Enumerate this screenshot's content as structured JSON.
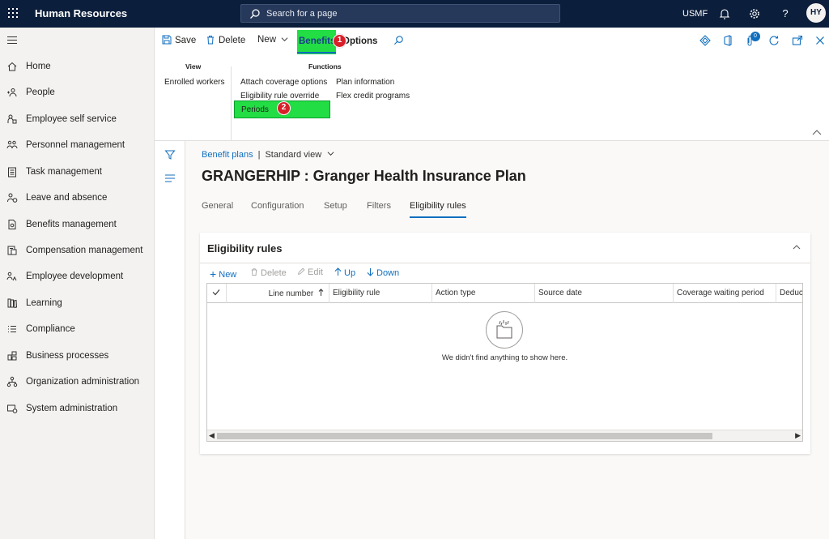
{
  "app": {
    "title": "Human Resources",
    "company": "USMF",
    "user_initials": "HY",
    "notification_count": "0"
  },
  "search": {
    "placeholder": "Search for a page"
  },
  "sidebar": {
    "items": [
      {
        "label": "Home",
        "icon": "home-icon"
      },
      {
        "label": "People",
        "icon": "people-icon"
      },
      {
        "label": "Employee self service",
        "icon": "employee-self-service-icon"
      },
      {
        "label": "Personnel management",
        "icon": "personnel-management-icon"
      },
      {
        "label": "Task management",
        "icon": "task-management-icon"
      },
      {
        "label": "Leave and absence",
        "icon": "leave-absence-icon"
      },
      {
        "label": "Benefits management",
        "icon": "benefits-management-icon"
      },
      {
        "label": "Compensation management",
        "icon": "compensation-management-icon"
      },
      {
        "label": "Employee development",
        "icon": "employee-development-icon"
      },
      {
        "label": "Learning",
        "icon": "learning-icon"
      },
      {
        "label": "Compliance",
        "icon": "compliance-icon"
      },
      {
        "label": "Business processes",
        "icon": "business-processes-icon"
      },
      {
        "label": "Organization administration",
        "icon": "organization-administration-icon"
      },
      {
        "label": "System administration",
        "icon": "system-administration-icon"
      }
    ]
  },
  "actionbar": {
    "save": "Save",
    "delete": "Delete",
    "new": "New",
    "tab_benefits": "Benefits",
    "tab_options": "Options"
  },
  "markers": {
    "m1": "1",
    "m2": "2"
  },
  "ribbon": {
    "view_header": "View",
    "functions_header": "Functions",
    "view_items": [
      "Enrolled workers"
    ],
    "functions_col1": [
      "Attach coverage options",
      "Eligibility rule override",
      "Periods"
    ],
    "functions_col2": [
      "Plan information",
      "Flex credit programs"
    ]
  },
  "breadcrumb": {
    "parent": "Benefit plans",
    "separator": "|",
    "view": "Standard view"
  },
  "page": {
    "title": "GRANGERHIP : Granger Health Insurance Plan"
  },
  "tabs": [
    {
      "label": "General"
    },
    {
      "label": "Configuration"
    },
    {
      "label": "Setup"
    },
    {
      "label": "Filters"
    },
    {
      "label": "Eligibility rules",
      "active": true
    }
  ],
  "section": {
    "title": "Eligibility rules",
    "toolbar": {
      "new": "New",
      "delete": "Delete",
      "edit": "Edit",
      "up": "Up",
      "down": "Down"
    },
    "columns": [
      "Line number",
      "Eligibility rule",
      "Action type",
      "Source date",
      "Coverage waiting period",
      "Deduc"
    ],
    "empty_message": "We didn't find anything to show here."
  },
  "colors": {
    "topbar": "#0b1e3b",
    "accent": "#106ebe",
    "highlight": "#22dd44",
    "marker": "#d8202a"
  }
}
